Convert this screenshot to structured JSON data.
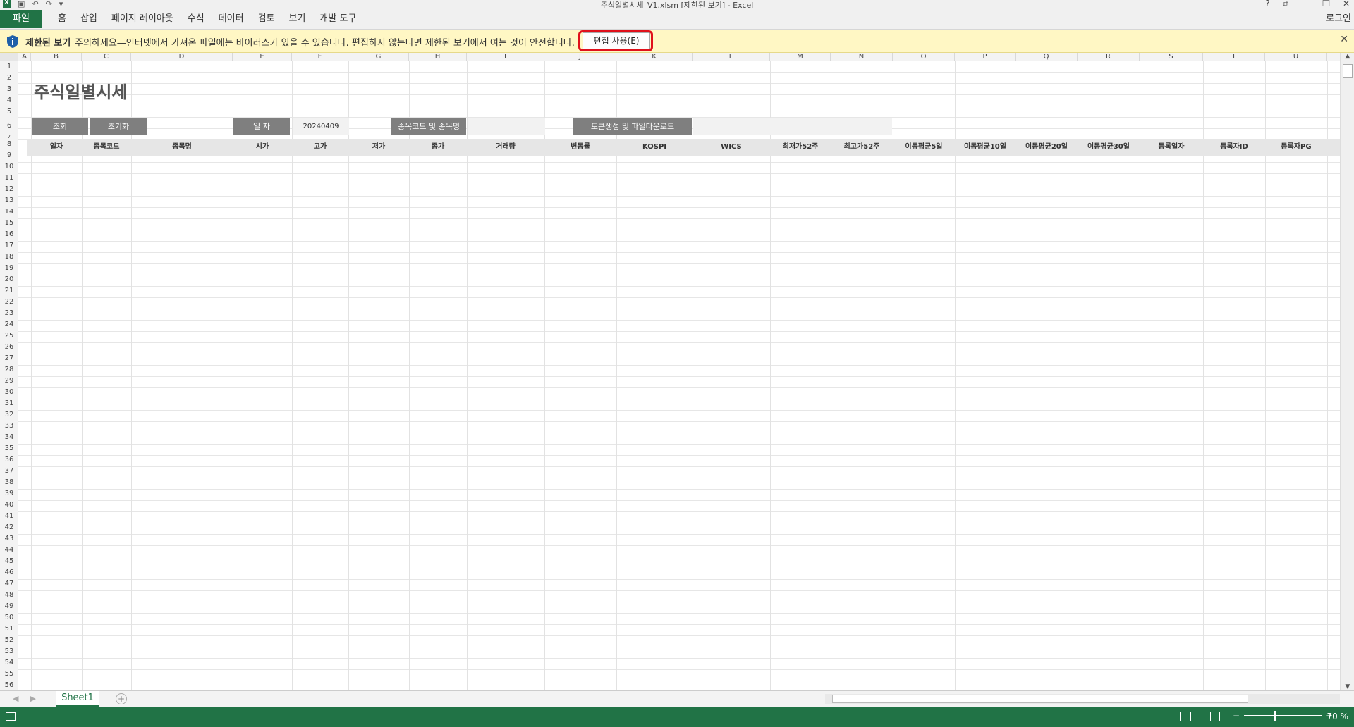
{
  "window": {
    "title": "주식일별시세_V1.xlsm  [제한된 보기] - Excel",
    "excel_badge": "X",
    "qat_icons": [
      "save-icon",
      "undo-icon",
      "redo-icon",
      "customize-icon"
    ],
    "controls": [
      "?",
      "⧉",
      "—",
      "❐",
      "✕"
    ]
  },
  "ribbon": {
    "file_label": "파일",
    "tabs": [
      "홈",
      "삽입",
      "페이지 레이아웃",
      "수식",
      "데이터",
      "검토",
      "보기",
      "개발 도구"
    ],
    "login_label": "로그인"
  },
  "message_bar": {
    "title": "제한된 보기",
    "message": "주의하세요—인터넷에서 가져온 파일에는 바이러스가 있을 수 있습니다. 편집하지 않는다면 제한된 보기에서 여는 것이 안전합니다.",
    "enable_button": "편집 사용(E)",
    "close": "✕",
    "highlight_color": "#e0101a"
  },
  "columns": [
    "A",
    "B",
    "C",
    "D",
    "E",
    "F",
    "G",
    "H",
    "I",
    "J",
    "K",
    "L",
    "M",
    "N",
    "O",
    "P",
    "Q",
    "R",
    "S",
    "T",
    "U"
  ],
  "rows": [
    "1",
    "2",
    "3",
    "4",
    "5",
    "6",
    "7",
    "8",
    "9",
    "10",
    "11",
    "12",
    "13",
    "14",
    "15",
    "16",
    "17",
    "18",
    "19",
    "20",
    "21",
    "22",
    "23",
    "24",
    "25",
    "26",
    "27",
    "28",
    "29",
    "30",
    "31",
    "32",
    "33",
    "34",
    "35",
    "36",
    "37",
    "38",
    "39",
    "40",
    "41",
    "42",
    "43",
    "44",
    "45",
    "46",
    "47",
    "48",
    "49",
    "50",
    "51",
    "52",
    "53",
    "54",
    "55",
    "56"
  ],
  "sheet": {
    "title": "주식일별시세",
    "query_button": "조회",
    "reset_button": "초기화",
    "date_label": "일     자",
    "date_value": "20240409",
    "stock_label": "종목코드 및 종목명",
    "stock_value": "",
    "token_button": "토큰생성 및 파일다운로드",
    "token_value": "",
    "headers": [
      "일자",
      "종목코드",
      "종목명",
      "시가",
      "고가",
      "저가",
      "종가",
      "거래량",
      "변동률",
      "KOSPI",
      "WICS",
      "최저가52주",
      "최고가52주",
      "이동평균5일",
      "이동평균10일",
      "이동평균20일",
      "이동평균30일",
      "등록일자",
      "등록자ID",
      "등록자PG"
    ]
  },
  "tabs_bar": {
    "sheet_name": "Sheet1",
    "add": "+"
  },
  "status": {
    "zoom": "70 %",
    "minus": "−",
    "plus": "+",
    "accent": "#217346"
  }
}
